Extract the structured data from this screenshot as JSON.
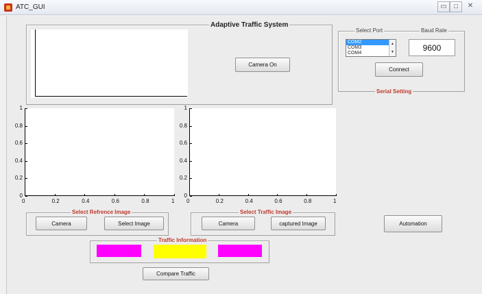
{
  "window": {
    "title": "ATC_GUI",
    "controls": [
      "▭",
      "□",
      "✕"
    ]
  },
  "main_panel": {
    "title": "Adaptive Traffic System"
  },
  "camera_button": "Camera On",
  "serial": {
    "title": "Serial Setting",
    "port_label": "Select Port",
    "baud_label": "Baud Rate",
    "ports": [
      "COM2",
      "COM3",
      "COM4"
    ],
    "selected_port_index": 0,
    "baud_value": "9600",
    "connect_label": "Connect"
  },
  "axes_left": {
    "y_ticks": [
      "1",
      "0.8",
      "0.6",
      "0.4",
      "0.2",
      "0"
    ],
    "x_ticks": [
      "0",
      "0.2",
      "0.4",
      "0.6",
      "0.8",
      "1"
    ]
  },
  "axes_right": {
    "y_ticks": [
      "1",
      "0.8",
      "0.6",
      "0.4",
      "0.2",
      "0"
    ],
    "x_ticks": [
      "0",
      "0.2",
      "0.4",
      "0.6",
      "0.8",
      "1"
    ]
  },
  "reference_panel": {
    "title": "Select Refrence Image",
    "camera_label": "Camera",
    "select_label": "Select Image"
  },
  "traffic_image_panel": {
    "title": "Select Traffic Image",
    "camera_label": "Camera",
    "captured_label": "captured Image"
  },
  "automation_label": "Automation",
  "traffic_info": {
    "title": "Traffic Information",
    "colors": [
      "#ff00ff",
      "#ffff00",
      "#ff00ff"
    ]
  },
  "compare_label": "Compare Traffic"
}
